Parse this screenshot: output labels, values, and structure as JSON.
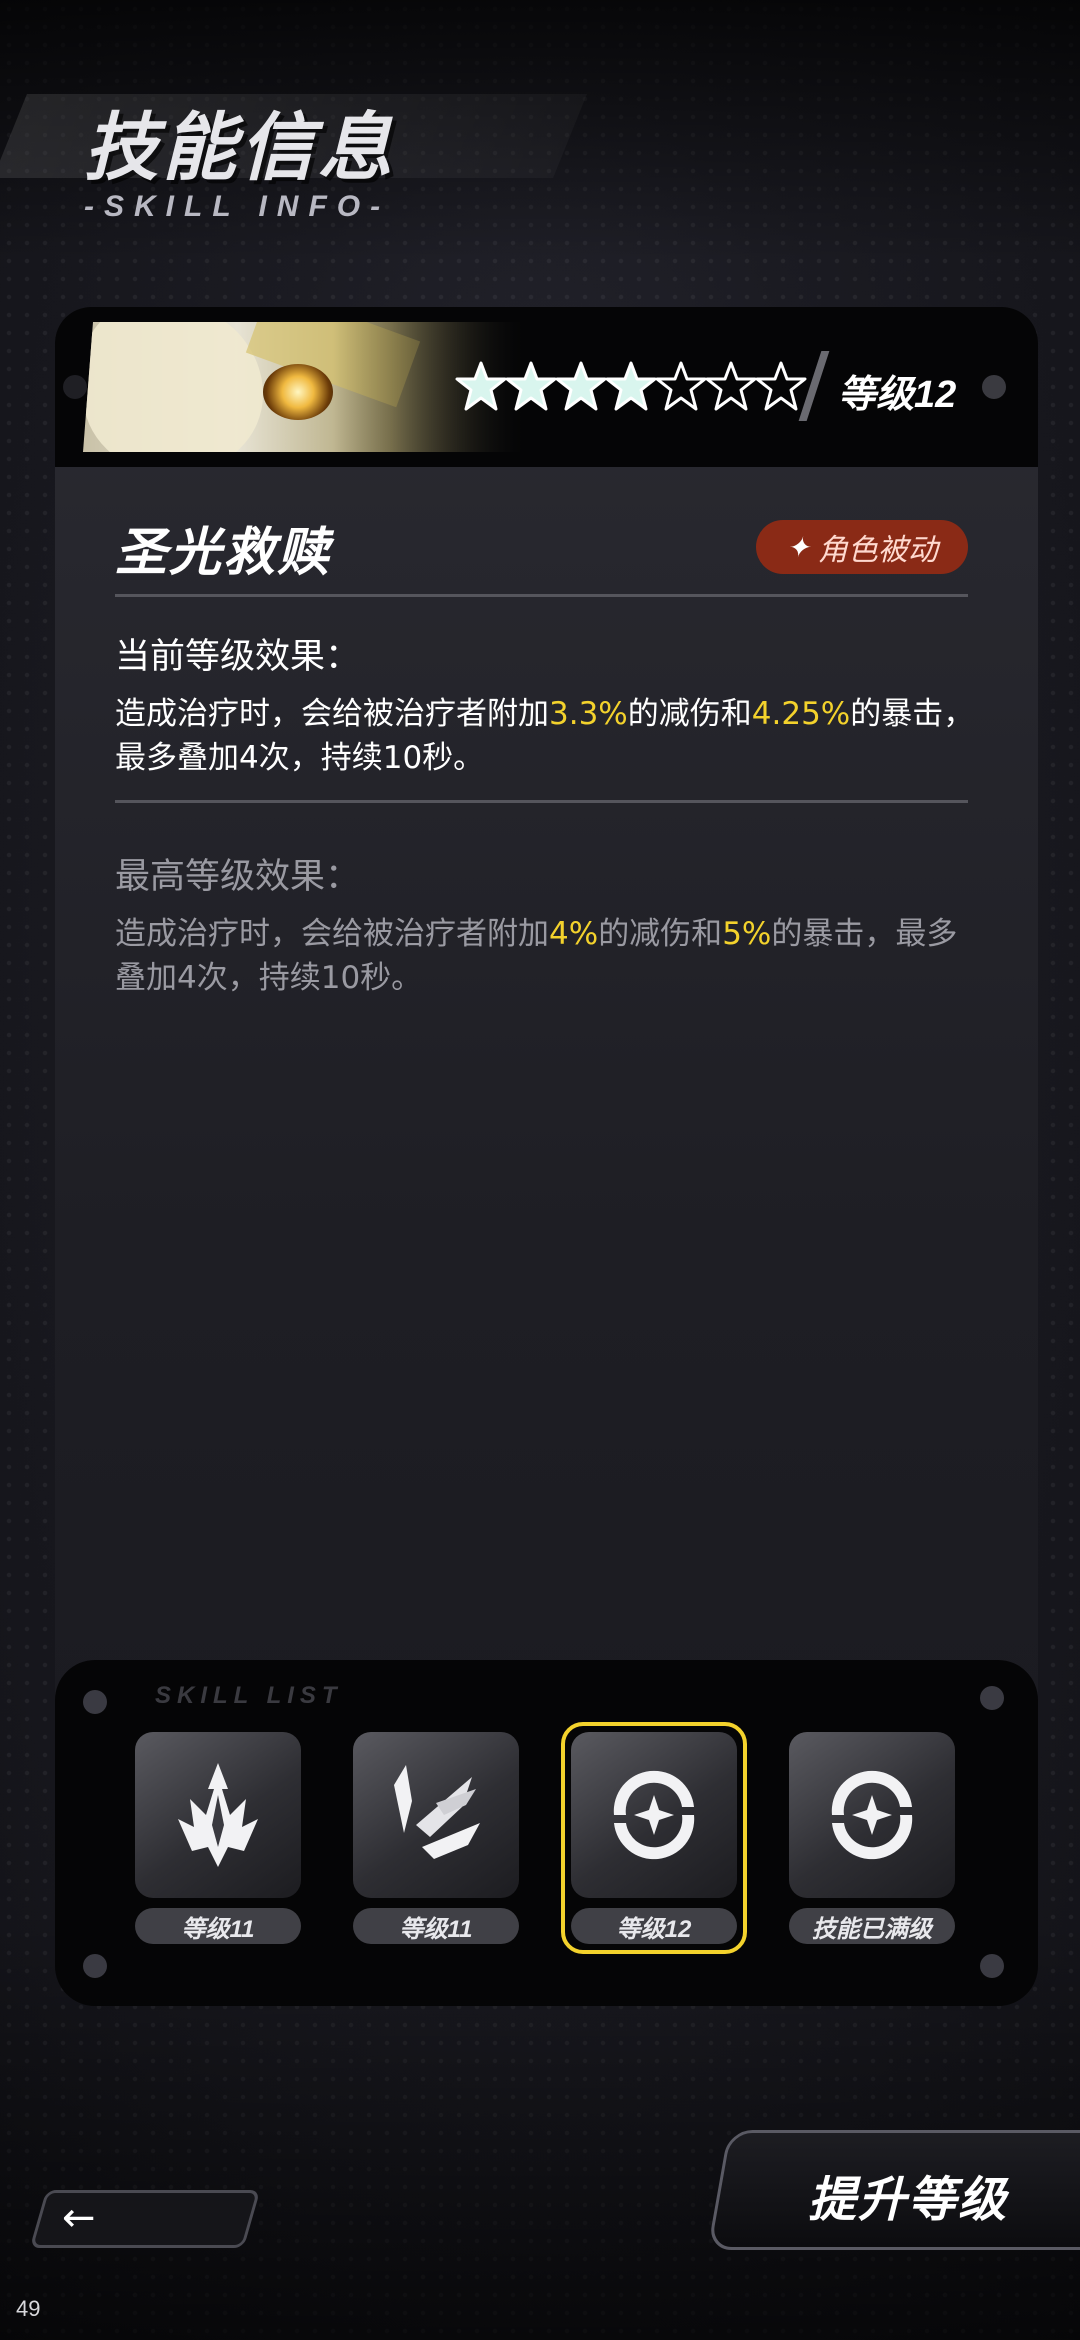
{
  "header": {
    "title": "技能信息",
    "subtitle": "-SKILL INFO-"
  },
  "skill_card": {
    "stars_filled": 4,
    "stars_total": 7,
    "level_label": "等级12",
    "skill_name": "圣光救赎",
    "type_badge": "角色被动",
    "current_title": "当前等级效果：",
    "current_effect": {
      "p1": "造成治疗时，会给被治疗者附加",
      "v1": "3.3%",
      "p2": "的减伤和",
      "v2": "4.25%",
      "p3": "的暴击，最多叠加4次，持续10秒。"
    },
    "max_title": "最高等级效果：",
    "max_effect": {
      "p1": "造成治疗时，会给被治疗者附加",
      "v1": "4%",
      "p2": "的减伤和",
      "v2": "5%",
      "p3": "的暴击，最多叠加4次，持续10秒。"
    }
  },
  "skill_list": {
    "label": "SKILL LIST",
    "slots": [
      {
        "icon": "crest-icon",
        "label": "等级11",
        "selected": false
      },
      {
        "icon": "feather-blades-icon",
        "label": "等级11",
        "selected": false
      },
      {
        "icon": "orb-star-icon",
        "label": "等级12",
        "selected": true
      },
      {
        "icon": "orb-star-icon",
        "label": "技能已满级",
        "selected": false
      }
    ]
  },
  "controls": {
    "back_symbol": "←",
    "upgrade_label": "提升等级"
  },
  "page_number": "49",
  "colors": {
    "highlight": "#f3d22c",
    "badge_bg": "#8a2a16",
    "selected_frame": "#f3d22c"
  }
}
